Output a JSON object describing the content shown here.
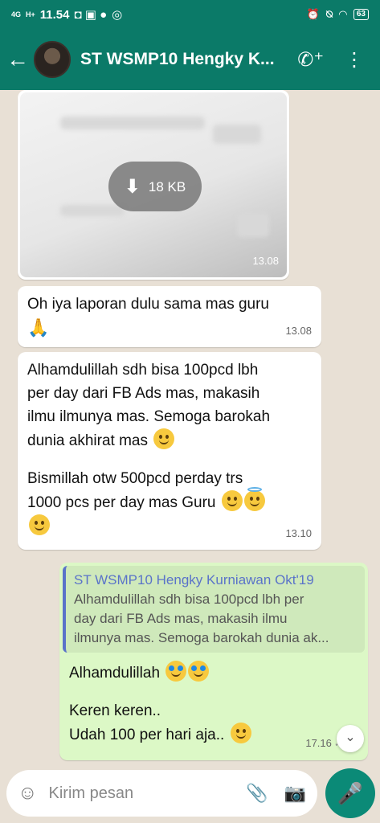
{
  "statusbar": {
    "network": "4G",
    "network2": "H+",
    "time": "11.54",
    "battery": "63"
  },
  "header": {
    "title": "ST WSMP10 Hengky K...",
    "back_icon": "arrow-left-icon",
    "call_icon": "add-call-icon",
    "menu_icon": "more-vert-icon"
  },
  "messages": {
    "image": {
      "size": "18 KB",
      "time": "13.08"
    },
    "msg1": {
      "text": "Oh iya laporan dulu sama mas guru",
      "time": "13.08"
    },
    "msg2": {
      "line1": "Alhamdulillah sdh bisa 100pcd lbh",
      "line2": "per day dari FB Ads mas, makasih",
      "line3": "ilmu ilmunya mas. Semoga barokah",
      "line4": "dunia akhirat mas",
      "line5": "Bismillah otw 500pcd perday trs",
      "line6": "1000 pcs per day mas Guru",
      "time": "13.10"
    },
    "reply": {
      "quote_name": "ST WSMP10 Hengky Kurniawan Okt'19",
      "quote_line1": "Alhamdulillah sdh bisa 100pcd lbh per",
      "quote_line2": "day dari FB Ads mas, makasih ilmu",
      "quote_line3": "ilmunya mas. Semoga barokah dunia ak...",
      "line1": "Alhamdulillah",
      "line2": "Keren keren..",
      "line3": "Udah 100 per hari aja..",
      "time": "17.16"
    }
  },
  "input": {
    "placeholder": "Kirim pesan"
  }
}
